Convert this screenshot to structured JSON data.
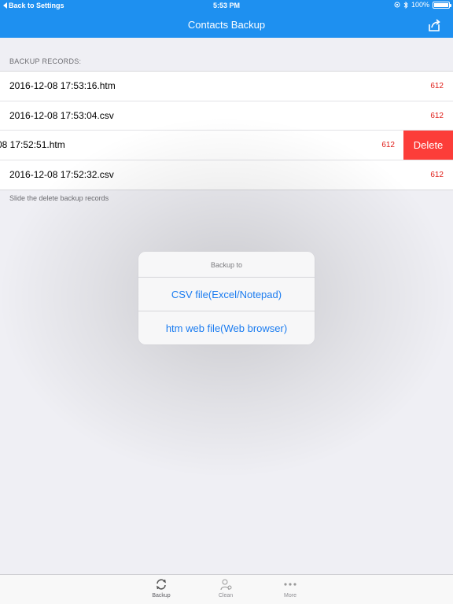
{
  "status_bar": {
    "back_label": "Back to Settings",
    "time": "5:53 PM",
    "battery": "100%",
    "icons": [
      "lock-rotation-icon",
      "bluetooth-icon",
      "battery-icon"
    ]
  },
  "nav": {
    "title": "Contacts Backup",
    "share_icon": "share-icon"
  },
  "records": {
    "header": "BACKUP RECORDS:",
    "items": [
      {
        "name": "2016-12-08 17:53:16.htm",
        "count": "612"
      },
      {
        "name": "2016-12-08 17:53:04.csv",
        "count": "612"
      },
      {
        "name": "08 17:52:51.htm",
        "count": "612",
        "delete_label": "Delete"
      },
      {
        "name": "2016-12-08 17:52:32.csv",
        "count": "612"
      }
    ],
    "hint": "Slide the delete backup records"
  },
  "dialog": {
    "title": "Backup to",
    "options": [
      "CSV file(Excel/Notepad)",
      "htm web file(Web browser)"
    ]
  },
  "tabs": [
    {
      "label": "Backup",
      "icon": "sync-icon"
    },
    {
      "label": "Clean",
      "icon": "person-clean-icon"
    },
    {
      "label": "More",
      "icon": "more-dots-icon"
    }
  ],
  "colors": {
    "nav_blue": "#1e90f0",
    "delete_red": "#fc3d39",
    "count_red": "#e0201b",
    "link_blue": "#1b7cf0"
  }
}
